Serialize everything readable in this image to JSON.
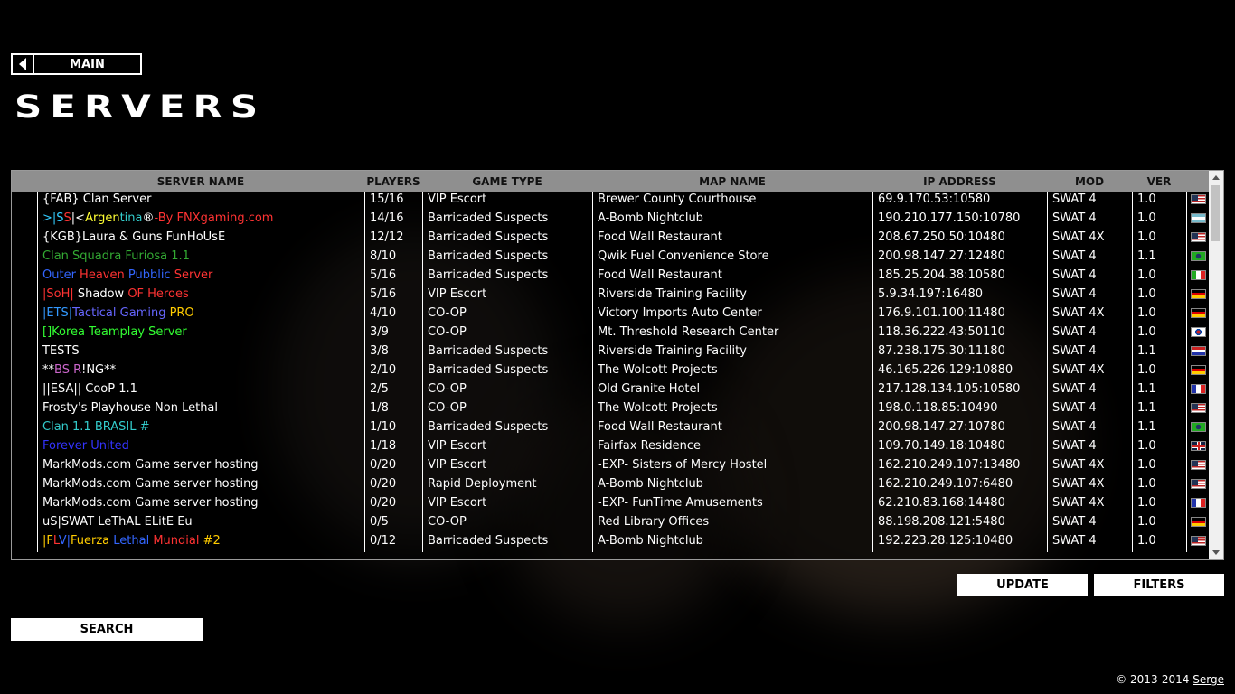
{
  "nav": {
    "main_label": "MAIN"
  },
  "page": {
    "title": "SERVERS"
  },
  "table": {
    "headers": [
      "",
      "SERVER NAME",
      "PLAYERS",
      "GAME TYPE",
      "MAP NAME",
      "IP ADDRESS",
      "MOD",
      "VER",
      ""
    ],
    "rows": [
      {
        "name": [
          {
            "t": "{FAB} Clan Server",
            "c": "#ffffff"
          }
        ],
        "players": "15/16",
        "gametype": "VIP Escort",
        "map": "Brewer County Courthouse",
        "ip": "69.9.170.53:10580",
        "mod": "SWAT 4",
        "ver": "1.0",
        "flag": "us"
      },
      {
        "name": [
          {
            "t": ">|S",
            "c": "#33ccff"
          },
          {
            "t": "S",
            "c": "#ff3333"
          },
          {
            "t": "|<",
            "c": "#ffffff"
          },
          {
            "t": "Argen",
            "c": "#ffff33"
          },
          {
            "t": "tina",
            "c": "#33cccc"
          },
          {
            "t": "®",
            "c": "#ffffff"
          },
          {
            "t": "-By ",
            "c": "#ff3333"
          },
          {
            "t": "FNXgaming.com",
            "c": "#ff3333"
          }
        ],
        "players": "14/16",
        "gametype": "Barricaded Suspects",
        "map": "A-Bomb Nightclub",
        "ip": "190.210.177.150:10780",
        "mod": "SWAT 4",
        "ver": "1.0",
        "flag": "ar"
      },
      {
        "name": [
          {
            "t": "{KGB}Laura & Guns FunHoUsE",
            "c": "#ffffff"
          }
        ],
        "players": "12/12",
        "gametype": "Barricaded Suspects",
        "map": "Food Wall Restaurant",
        "ip": "208.67.250.50:10480",
        "mod": "SWAT 4X",
        "ver": "1.0",
        "flag": "us"
      },
      {
        "name": [
          {
            "t": "Clan Squadra Furiosa 1.1",
            "c": "#33aa33"
          }
        ],
        "players": "8/10",
        "gametype": "Barricaded Suspects",
        "map": "Qwik Fuel Convenience Store",
        "ip": "200.98.147.27:12480",
        "mod": "SWAT 4",
        "ver": "1.1",
        "flag": "br"
      },
      {
        "name": [
          {
            "t": "Outer ",
            "c": "#3366ff"
          },
          {
            "t": "Heaven ",
            "c": "#ff3333"
          },
          {
            "t": "Pubblic ",
            "c": "#3366ff"
          },
          {
            "t": "Server",
            "c": "#ff3333"
          }
        ],
        "players": "5/16",
        "gametype": "Barricaded Suspects",
        "map": "Food Wall Restaurant",
        "ip": "185.25.204.38:10580",
        "mod": "SWAT 4",
        "ver": "1.0",
        "flag": "it"
      },
      {
        "name": [
          {
            "t": "|SoH| ",
            "c": "#ff3333"
          },
          {
            "t": "Shadow ",
            "c": "#ffffff"
          },
          {
            "t": "OF Heroes",
            "c": "#ff3333"
          }
        ],
        "players": "5/16",
        "gametype": "VIP Escort",
        "map": "Riverside Training Facility",
        "ip": "5.9.34.197:16480",
        "mod": "SWAT 4",
        "ver": "1.0",
        "flag": "de"
      },
      {
        "name": [
          {
            "t": "|ETS|",
            "c": "#3399ff"
          },
          {
            "t": "Tactical Gaming ",
            "c": "#6666ff"
          },
          {
            "t": "PRO",
            "c": "#ffcc00"
          }
        ],
        "players": "4/10",
        "gametype": "CO-OP",
        "map": "Victory Imports Auto Center",
        "ip": "176.9.101.100:11480",
        "mod": "SWAT 4X",
        "ver": "1.0",
        "flag": "de"
      },
      {
        "name": [
          {
            "t": "[]Korea Teamplay Server",
            "c": "#33ff33"
          }
        ],
        "players": "3/9",
        "gametype": "CO-OP",
        "map": "Mt. Threshold Research Center",
        "ip": "118.36.222.43:50110",
        "mod": "SWAT 4",
        "ver": "1.0",
        "flag": "kr"
      },
      {
        "name": [
          {
            "t": "TESTS",
            "c": "#ffffff"
          }
        ],
        "players": "3/8",
        "gametype": "Barricaded Suspects",
        "map": "Riverside Training Facility",
        "ip": "87.238.175.30:11180",
        "mod": "SWAT 4",
        "ver": "1.1",
        "flag": "nl"
      },
      {
        "name": [
          {
            "t": "**",
            "c": "#ffffff"
          },
          {
            "t": "BS R",
            "c": "#cc66cc"
          },
          {
            "t": "!",
            "c": "#ffffff"
          },
          {
            "t": "NG",
            "c": "#ffffff"
          },
          {
            "t": "**",
            "c": "#ffffff"
          }
        ],
        "players": "2/10",
        "gametype": "Barricaded Suspects",
        "map": "The Wolcott Projects",
        "ip": "46.165.226.129:10880",
        "mod": "SWAT 4X",
        "ver": "1.0",
        "flag": "de"
      },
      {
        "name": [
          {
            "t": "||ESA|| CooP 1.1",
            "c": "#ffffff"
          }
        ],
        "players": "2/5",
        "gametype": "CO-OP",
        "map": "Old Granite Hotel",
        "ip": "217.128.134.105:10580",
        "mod": "SWAT 4",
        "ver": "1.1",
        "flag": "fr"
      },
      {
        "name": [
          {
            "t": "Frosty's Playhouse Non Lethal",
            "c": "#ffffff"
          }
        ],
        "players": "1/8",
        "gametype": "CO-OP",
        "map": "The Wolcott Projects",
        "ip": "198.0.118.85:10490",
        "mod": "SWAT 4",
        "ver": "1.1",
        "flag": "us"
      },
      {
        "name": [
          {
            "t": "Clan 1.1 BRASIL #",
            "c": "#33cccc"
          }
        ],
        "players": "1/10",
        "gametype": "Barricaded Suspects",
        "map": "Food Wall Restaurant",
        "ip": "200.98.147.27:10780",
        "mod": "SWAT 4",
        "ver": "1.1",
        "flag": "br"
      },
      {
        "name": [
          {
            "t": "Forever United",
            "c": "#3333ff"
          }
        ],
        "players": "1/18",
        "gametype": "VIP Escort",
        "map": "Fairfax Residence",
        "ip": "109.70.149.18:10480",
        "mod": "SWAT 4",
        "ver": "1.0",
        "flag": "gb"
      },
      {
        "name": [
          {
            "t": "MarkMods.com Game server hosting",
            "c": "#ffffff"
          }
        ],
        "players": "0/20",
        "gametype": "VIP Escort",
        "map": "-EXP- Sisters of Mercy Hostel",
        "ip": "162.210.249.107:13480",
        "mod": "SWAT 4X",
        "ver": "1.0",
        "flag": "us"
      },
      {
        "name": [
          {
            "t": "MarkMods.com Game server hosting",
            "c": "#ffffff"
          }
        ],
        "players": "0/20",
        "gametype": "Rapid Deployment",
        "map": "A-Bomb Nightclub",
        "ip": "162.210.249.107:6480",
        "mod": "SWAT 4X",
        "ver": "1.0",
        "flag": "us"
      },
      {
        "name": [
          {
            "t": "MarkMods.com Game server hosting",
            "c": "#ffffff"
          }
        ],
        "players": "0/20",
        "gametype": "VIP Escort",
        "map": "-EXP- FunTime Amusements",
        "ip": "62.210.83.168:14480",
        "mod": "SWAT 4X",
        "ver": "1.0",
        "flag": "fr"
      },
      {
        "name": [
          {
            "t": "uS|SWAT LeThAL ELitE Eu",
            "c": "#ffffff"
          }
        ],
        "players": "0/5",
        "gametype": "CO-OP",
        "map": "Red Library Offices",
        "ip": "88.198.208.121:5480",
        "mod": "SWAT 4",
        "ver": "1.0",
        "flag": "de"
      },
      {
        "name": [
          {
            "t": "|F",
            "c": "#ffcc00"
          },
          {
            "t": "L",
            "c": "#ff3333"
          },
          {
            "t": "V|",
            "c": "#3366ff"
          },
          {
            "t": "Fuerza ",
            "c": "#ffcc00"
          },
          {
            "t": "Lethal ",
            "c": "#3366ff"
          },
          {
            "t": "Mundial ",
            "c": "#ff3333"
          },
          {
            "t": "#2",
            "c": "#ffcc00"
          }
        ],
        "players": "0/12",
        "gametype": "Barricaded Suspects",
        "map": "A-Bomb Nightclub",
        "ip": "192.223.28.125:10480",
        "mod": "SWAT 4",
        "ver": "1.0",
        "flag": "us"
      }
    ]
  },
  "buttons": {
    "update": "UPDATE",
    "filters": "FILTERS",
    "search": "SEARCH"
  },
  "footer": {
    "copyright": "© 2013-2014 ",
    "author": "Serge"
  },
  "colors": {
    "header_bg": "#8f8f8f",
    "button_bg": "#ffffff",
    "page_bg": "#000000"
  }
}
